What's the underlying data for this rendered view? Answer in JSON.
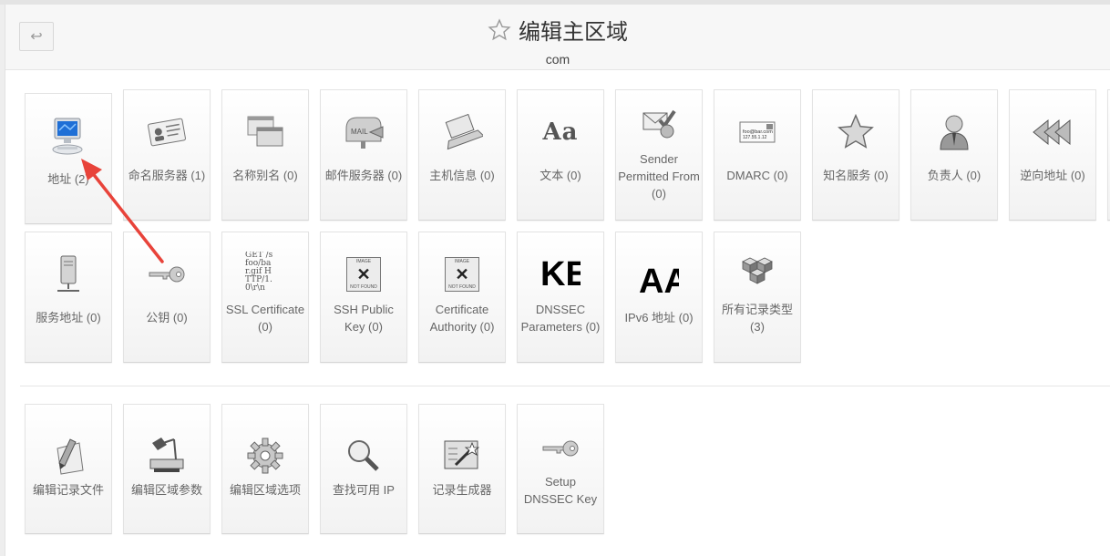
{
  "header": {
    "title": "编辑主区域",
    "subtitle": "com",
    "back_icon": "↩"
  },
  "record_types": [
    {
      "label": "地址 (2)",
      "icon": "computer-icon"
    },
    {
      "label": "命名服务器 (1)",
      "icon": "id-card-icon"
    },
    {
      "label": "名称别名 (0)",
      "icon": "windows-stack-icon"
    },
    {
      "label": "邮件服务器 (0)",
      "icon": "mailbox-icon"
    },
    {
      "label": "主机信息 (0)",
      "icon": "laptop-icon"
    },
    {
      "label": "文本 (0)",
      "icon": "text-aa-icon"
    },
    {
      "label": "Sender Permitted From (0)",
      "icon": "mail-check-icon"
    },
    {
      "label": "DMARC (0)",
      "icon": "email-card-icon"
    },
    {
      "label": "知名服务 (0)",
      "icon": "star-icon"
    },
    {
      "label": "负责人 (0)",
      "icon": "person-icon"
    },
    {
      "label": "逆向地址 (0)",
      "icon": "rewind-icon"
    },
    {
      "label": "服务地址 (0)",
      "icon": "server-icon"
    },
    {
      "label": "公钥 (0)",
      "icon": "key-icon"
    },
    {
      "label": "SSL Certificate (0)",
      "icon": "certificate-text-icon"
    },
    {
      "label": "SSH Public Key (0)",
      "icon": "image-not-found-icon"
    },
    {
      "label": "Certificate Authority (0)",
      "icon": "image-not-found-icon"
    },
    {
      "label": "DNSSEC Parameters (0)",
      "icon": "ke-text-icon"
    },
    {
      "label": "IPv6 地址 (0)",
      "icon": "aa-text-icon"
    },
    {
      "label": "所有记录类型 (3)",
      "icon": "cubes-icon"
    }
  ],
  "actions": [
    {
      "label": "编辑记录文件",
      "icon": "pen-paper-icon"
    },
    {
      "label": "编辑区域参数",
      "icon": "lamp-icon"
    },
    {
      "label": "编辑区域选项",
      "icon": "gear-icon"
    },
    {
      "label": "查找可用 IP",
      "icon": "magnifier-icon"
    },
    {
      "label": "记录生成器",
      "icon": "wand-icon"
    },
    {
      "label": "Setup DNSSEC Key",
      "icon": "key-icon"
    }
  ],
  "icon_text": {
    "mail": "MAIL",
    "dmarc_line1": "foo@bar.com",
    "dmarc_line2": "127.55.1.12",
    "cert_lines": [
      "GET /s",
      "foo/ba",
      "r.gif H",
      "TTP/1.",
      "0\\r\\n"
    ],
    "image_top": "IMAGE",
    "image_bottom": "NOT FOUND",
    "ke": "KE",
    "aa": "AA",
    "text_aa": "Aa"
  },
  "colors": {
    "arrow": "#e8433a",
    "tile_border": "#e3e3e3",
    "label": "#666666"
  }
}
